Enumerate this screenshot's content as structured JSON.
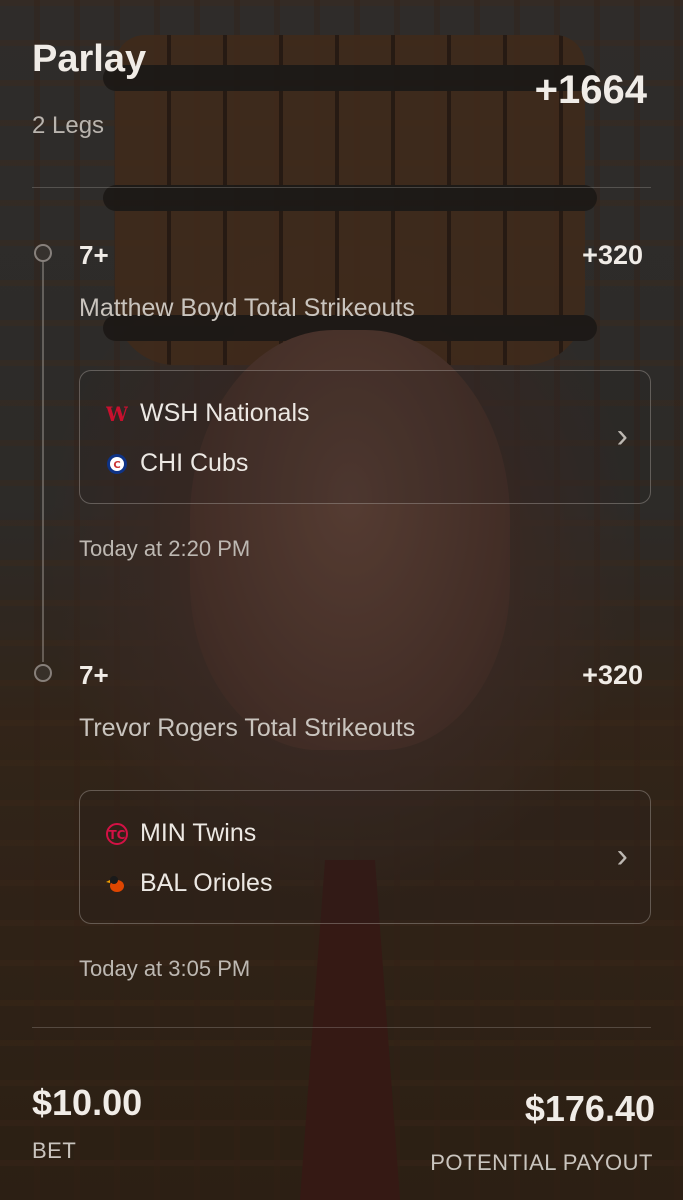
{
  "header": {
    "title": "Parlay",
    "legs_count": "2 Legs",
    "total_odds": "+1664"
  },
  "legs": [
    {
      "line": "7+",
      "odds": "+320",
      "market": "Matthew Boyd Total Strikeouts",
      "teams": [
        {
          "name": "WSH Nationals",
          "logo": "nationals-logo-icon",
          "color": "#c8102e"
        },
        {
          "name": "CHI Cubs",
          "logo": "cubs-logo-icon",
          "color": "#0e3386"
        }
      ],
      "time": "Today at 2:20 PM"
    },
    {
      "line": "7+",
      "odds": "+320",
      "market": "Trevor Rogers Total Strikeouts",
      "teams": [
        {
          "name": "MIN Twins",
          "logo": "twins-logo-icon",
          "color": "#d31145"
        },
        {
          "name": "BAL Orioles",
          "logo": "orioles-logo-icon",
          "color": "#df4601"
        }
      ],
      "time": "Today at 3:05 PM"
    }
  ],
  "footer": {
    "bet_amount": "$10.00",
    "bet_label": "BET",
    "payout_amount": "$176.40",
    "payout_label": "POTENTIAL PAYOUT"
  }
}
